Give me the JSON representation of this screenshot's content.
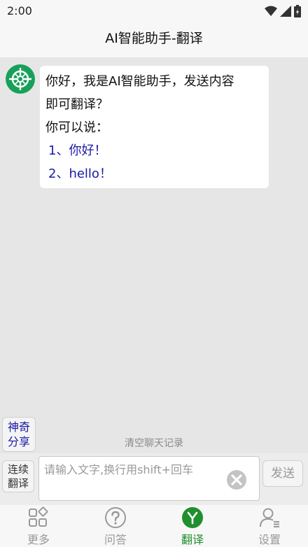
{
  "status": {
    "time": "2:00"
  },
  "header": {
    "title": "AI智能助手-翻译"
  },
  "chat": {
    "messages": [
      {
        "line1": "你好，我是AI智能助手，发送内容",
        "line2": "即可翻译？",
        "line3": "你可以说：",
        "option1": "1、你好！",
        "option2": "2、hello！"
      }
    ]
  },
  "actions": {
    "magic_line1": "神奇",
    "magic_line2": "分享",
    "clear_history": "清空聊天记录",
    "continuous_line1": "连续",
    "continuous_line2": "翻译",
    "input_placeholder": "请输入文字,换行用shift+回车",
    "send_label": "发送"
  },
  "tabs": [
    {
      "label": "更多",
      "icon": "grid-icon",
      "active": false
    },
    {
      "label": "问答",
      "icon": "question-icon",
      "active": false
    },
    {
      "label": "翻译",
      "icon": "translate-icon",
      "active": true
    },
    {
      "label": "设置",
      "icon": "settings-user-icon",
      "active": false
    }
  ],
  "colors": {
    "accent": "#1f8f2f",
    "option_text": "#1a1aa6"
  }
}
